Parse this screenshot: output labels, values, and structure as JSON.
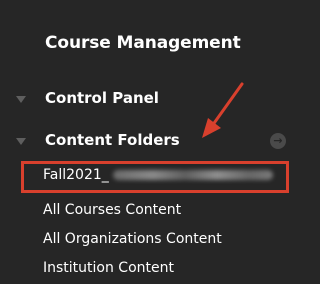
{
  "sidebar": {
    "title": "Course Management",
    "control_panel": {
      "label": "Control Panel"
    },
    "content_folders": {
      "label": "Content Folders"
    },
    "items": [
      {
        "label": "Fall2021_"
      },
      {
        "label": "All Courses Content"
      },
      {
        "label": "All Organizations Content"
      },
      {
        "label": "Institution Content"
      }
    ]
  },
  "colors": {
    "background": "#262626",
    "text": "#ffffff",
    "annotation": "#d8402d",
    "caret": "#5e5e5e"
  },
  "icons": {
    "caret": "chevron-down-icon",
    "circle_arrow": "circle-arrow-right-icon"
  }
}
